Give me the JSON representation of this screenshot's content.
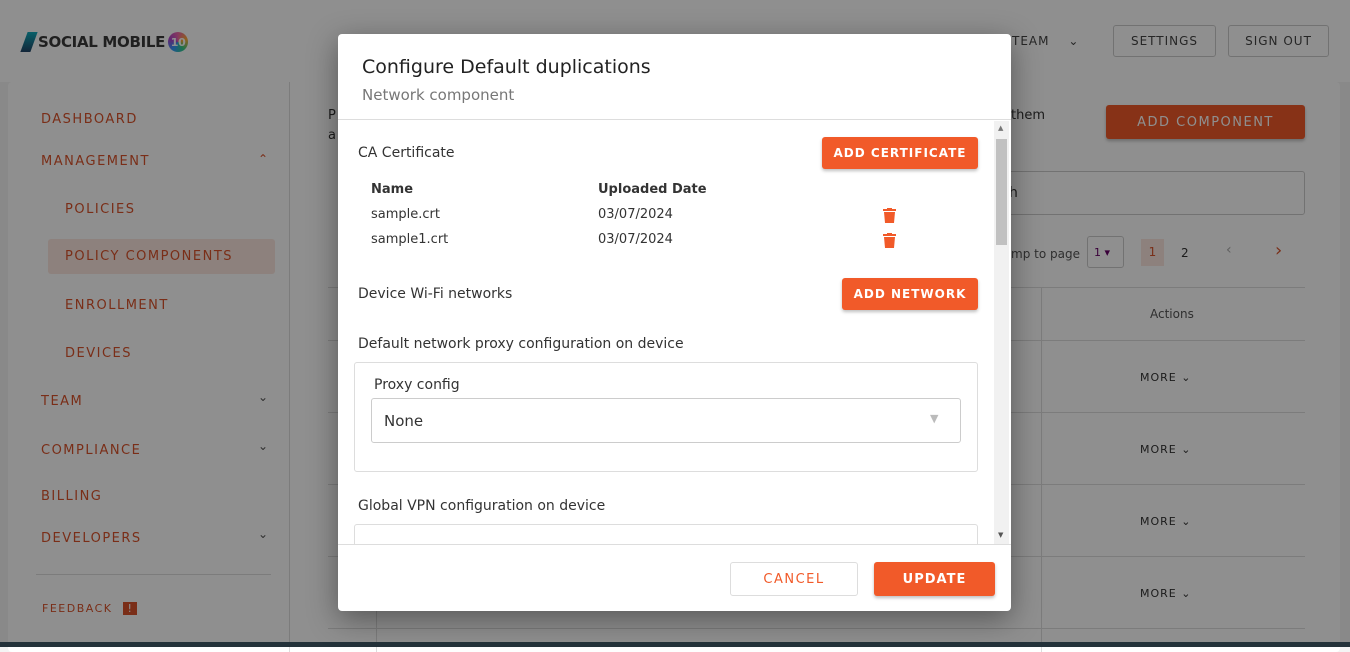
{
  "header": {
    "logo": "SOCIAL MOBILE",
    "logo_badge": "10",
    "team": "TEAM",
    "settings": "SETTINGS",
    "sign_out": "SIGN OUT"
  },
  "sidebar": {
    "items": [
      {
        "label": "DASHBOARD"
      },
      {
        "label": "MANAGEMENT"
      },
      {
        "label": "POLICIES"
      },
      {
        "label": "POLICY COMPONENTS"
      },
      {
        "label": "ENROLLMENT"
      },
      {
        "label": "DEVICES"
      },
      {
        "label": "TEAM"
      },
      {
        "label": "COMPLIANCE"
      },
      {
        "label": "BILLING"
      },
      {
        "label": "DEVELOPERS"
      }
    ],
    "feedback": "FEEDBACK"
  },
  "main": {
    "intro_a": "P",
    "intro_b": "a",
    "intro_tail": "them",
    "add_component": "ADD COMPONENT",
    "search_tail": "h",
    "jump_label": "mp to page",
    "jump_value": "1",
    "pages": [
      "1",
      "2"
    ],
    "actions_header": "Actions",
    "more": "MORE"
  },
  "modal": {
    "title": "Configure Default duplications",
    "subtitle": "Network component",
    "ca_label": "CA Certificate",
    "add_certificate": "ADD CERTIFICATE",
    "cert_headers": [
      "Name",
      "Uploaded Date"
    ],
    "certs": [
      {
        "name": "sample.crt",
        "date": "03/07/2024"
      },
      {
        "name": "sample1.crt",
        "date": "03/07/2024"
      }
    ],
    "wifi_label": "Device Wi-Fi networks",
    "add_network": "ADD NETWORK",
    "proxy_section": "Default network proxy configuration on device",
    "proxy_label": "Proxy config",
    "proxy_value": "None",
    "vpn_section": "Global VPN configuration on device",
    "cancel": "CANCEL",
    "update": "UPDATE"
  },
  "colors": {
    "accent": "#f15a29"
  }
}
